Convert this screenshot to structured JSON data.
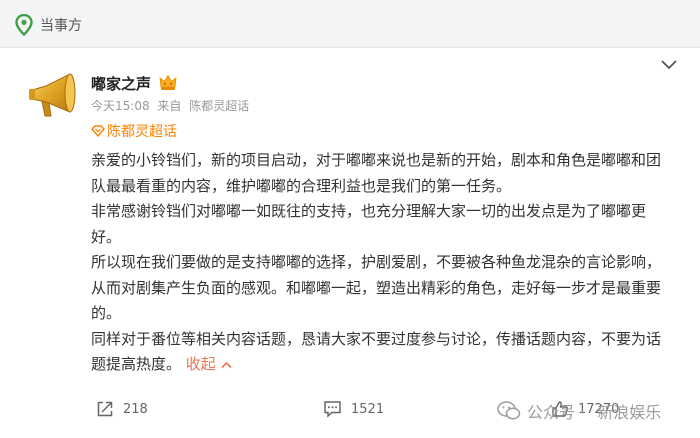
{
  "topbar": {
    "label": "当事方"
  },
  "post": {
    "author": "嘟家之声",
    "time": "今天15:08",
    "source_prefix": "来自",
    "source": "陈都灵超话",
    "topic": "陈都灵超话",
    "lines": [
      "亲爱的小铃铛们，新的项目启动，对于嘟嘟来说也是新的开始，剧本和角色是嘟嘟和团",
      "队最最看重的内容，维护嘟嘟的合理利益也是我们的第一任务。",
      "非常感谢铃铛们对嘟嘟一如既往的支持，也充分理解大家一切的出发点是为了嘟嘟更",
      "好。",
      "所以现在我们要做的是支持嘟嘟的选择，护剧爱剧，不要被各种鱼龙混杂的言论影响，",
      "从而对剧集产生负面的感观。和嘟嘟一起，塑造出精彩的角色，走好每一步才是最重要",
      "的。",
      "同样对于番位等相关内容话题，恳请大家不要过度参与讨论，传播话题内容，不要为话"
    ],
    "last_line": "题提高热度。",
    "collapse_label": "收起"
  },
  "actions": {
    "repost_count": "218",
    "comment_count": "1521",
    "like_count": "17270"
  },
  "watermark": {
    "prefix": "公众号 ·",
    "name": "新浪娱乐"
  },
  "colors": {
    "accent": "#ff8200",
    "collapse": "#eb7350",
    "topbar_bg": "#f3f4f6",
    "pin": "#43a047"
  }
}
